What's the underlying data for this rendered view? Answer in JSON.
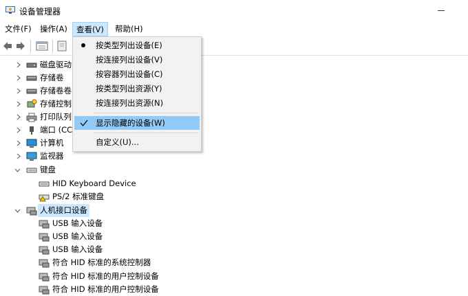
{
  "window": {
    "title": "设备管理器"
  },
  "menubar": [
    "文件(F)",
    "操作(A)",
    "查看(V)",
    "帮助(H)"
  ],
  "view_menu": {
    "items": [
      {
        "label": "按类型列出设备(E)",
        "mark": "bullet"
      },
      {
        "label": "按连接列出设备(V)",
        "mark": ""
      },
      {
        "label": "按容器列出设备(C)",
        "mark": ""
      },
      {
        "label": "按类型列出资源(Y)",
        "mark": ""
      },
      {
        "label": "按连接列出资源(N)",
        "mark": ""
      },
      {
        "label": "显示隐藏的设备(W)",
        "mark": "check",
        "highlighted": true
      },
      {
        "label": "自定义(U)...",
        "mark": ""
      }
    ]
  },
  "tree": {
    "categories_partial": [
      "磁盘驱动",
      "存储卷",
      "存储卷卷",
      "存储控制",
      "打印队列",
      "端口 (CC",
      "计算机",
      "监视器"
    ],
    "keyboard": {
      "label": "键盘",
      "children": [
        "HID Keyboard Device",
        "PS/2 标准键盘"
      ]
    },
    "hid": {
      "label": "人机接口设备",
      "children": [
        "USB 输入设备",
        "USB 输入设备",
        "USB 输入设备",
        "符合 HID 标准的系统控制器",
        "符合 HID 标准的用户控制设备",
        "符合 HID 标准的用户控制设备"
      ]
    }
  },
  "icons": {
    "back": "back-arrow-icon",
    "forward": "forward-arrow-icon",
    "properties": "properties-icon",
    "help": "help-icon"
  }
}
